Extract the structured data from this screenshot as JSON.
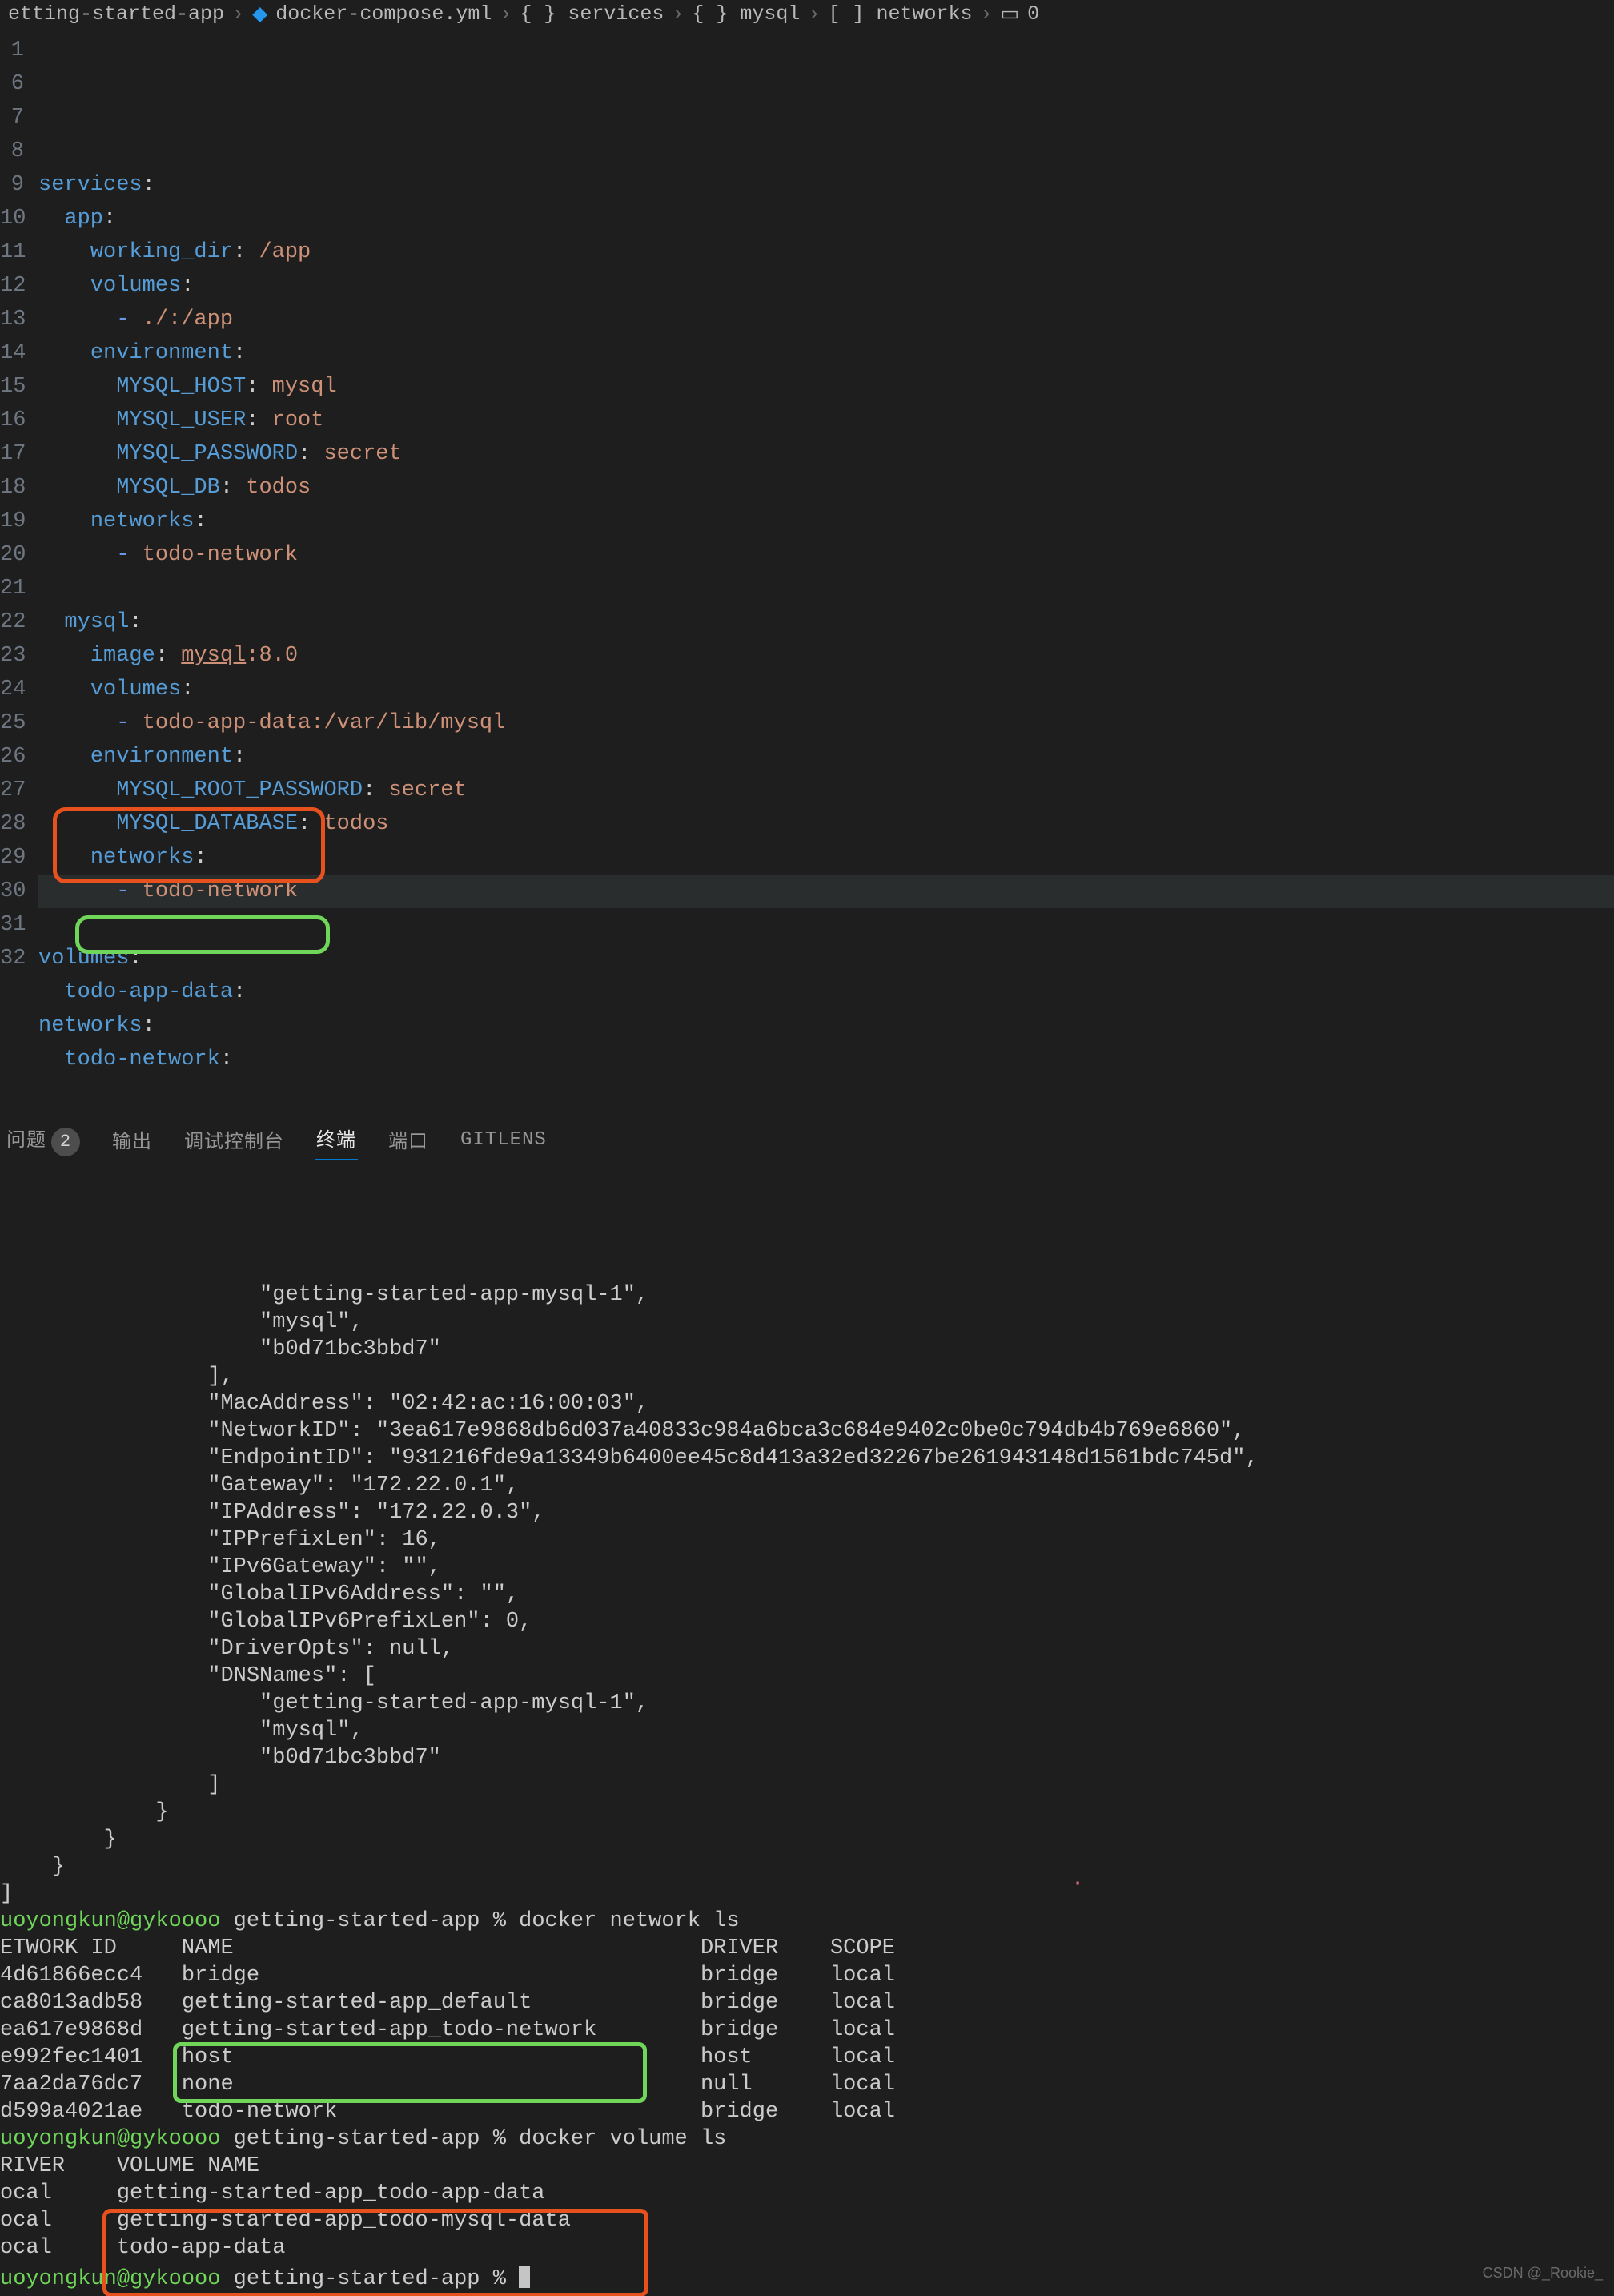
{
  "breadcrumb": {
    "segments": [
      "etting-started-app",
      "docker-compose.yml",
      "{ } services",
      "{ } mysql",
      "[ ] networks",
      "0"
    ],
    "icon_file": "file-icon",
    "icon_array": "array-icon"
  },
  "code": {
    "lines": [
      {
        "n": 1,
        "t": [
          {
            "c": "key",
            "s": "services"
          },
          {
            "c": "pun",
            "s": ":"
          }
        ]
      },
      {
        "n": 6,
        "t": [
          {
            "c": "",
            "s": "  "
          },
          {
            "c": "key",
            "s": "app"
          },
          {
            "c": "pun",
            "s": ":"
          }
        ]
      },
      {
        "n": 7,
        "t": [
          {
            "c": "",
            "s": "    "
          },
          {
            "c": "key",
            "s": "working_dir"
          },
          {
            "c": "pun",
            "s": ": "
          },
          {
            "c": "val",
            "s": "/app"
          }
        ]
      },
      {
        "n": 8,
        "t": [
          {
            "c": "",
            "s": "    "
          },
          {
            "c": "key",
            "s": "volumes"
          },
          {
            "c": "pun",
            "s": ":"
          }
        ]
      },
      {
        "n": 9,
        "t": [
          {
            "c": "",
            "s": "      "
          },
          {
            "c": "lst",
            "s": "- "
          },
          {
            "c": "val",
            "s": "./:/app"
          }
        ]
      },
      {
        "n": 10,
        "t": [
          {
            "c": "",
            "s": "    "
          },
          {
            "c": "key",
            "s": "environment"
          },
          {
            "c": "pun",
            "s": ":"
          }
        ]
      },
      {
        "n": 11,
        "t": [
          {
            "c": "",
            "s": "      "
          },
          {
            "c": "key",
            "s": "MYSQL_HOST"
          },
          {
            "c": "pun",
            "s": ": "
          },
          {
            "c": "val",
            "s": "mysql"
          }
        ]
      },
      {
        "n": 12,
        "t": [
          {
            "c": "",
            "s": "      "
          },
          {
            "c": "key",
            "s": "MYSQL_USER"
          },
          {
            "c": "pun",
            "s": ": "
          },
          {
            "c": "val",
            "s": "root"
          }
        ]
      },
      {
        "n": 13,
        "t": [
          {
            "c": "",
            "s": "      "
          },
          {
            "c": "key",
            "s": "MYSQL_PASSWORD"
          },
          {
            "c": "pun",
            "s": ": "
          },
          {
            "c": "val",
            "s": "secret"
          }
        ]
      },
      {
        "n": 14,
        "t": [
          {
            "c": "",
            "s": "      "
          },
          {
            "c": "key",
            "s": "MYSQL_DB"
          },
          {
            "c": "pun",
            "s": ": "
          },
          {
            "c": "val",
            "s": "todos"
          }
        ]
      },
      {
        "n": 15,
        "t": [
          {
            "c": "",
            "s": "    "
          },
          {
            "c": "key",
            "s": "networks"
          },
          {
            "c": "pun",
            "s": ":"
          }
        ]
      },
      {
        "n": 16,
        "t": [
          {
            "c": "",
            "s": "      "
          },
          {
            "c": "lst",
            "s": "- "
          },
          {
            "c": "val",
            "s": "todo-network"
          }
        ]
      },
      {
        "n": 17,
        "t": []
      },
      {
        "n": 18,
        "t": [
          {
            "c": "",
            "s": "  "
          },
          {
            "c": "key",
            "s": "mysql"
          },
          {
            "c": "pun",
            "s": ":"
          }
        ]
      },
      {
        "n": 19,
        "t": [
          {
            "c": "",
            "s": "    "
          },
          {
            "c": "key",
            "s": "image"
          },
          {
            "c": "pun",
            "s": ": "
          },
          {
            "c": "val u",
            "s": "mysql"
          },
          {
            "c": "val",
            "s": ":8.0"
          }
        ]
      },
      {
        "n": 20,
        "t": [
          {
            "c": "",
            "s": "    "
          },
          {
            "c": "key",
            "s": "volumes"
          },
          {
            "c": "pun",
            "s": ":"
          }
        ]
      },
      {
        "n": 21,
        "t": [
          {
            "c": "",
            "s": "      "
          },
          {
            "c": "lst",
            "s": "- "
          },
          {
            "c": "val",
            "s": "todo-app-data:/var/lib/mysql"
          }
        ]
      },
      {
        "n": 22,
        "t": [
          {
            "c": "",
            "s": "    "
          },
          {
            "c": "key",
            "s": "environment"
          },
          {
            "c": "pun",
            "s": ":"
          }
        ]
      },
      {
        "n": 23,
        "t": [
          {
            "c": "",
            "s": "      "
          },
          {
            "c": "key",
            "s": "MYSQL_ROOT_PASSWORD"
          },
          {
            "c": "pun",
            "s": ": "
          },
          {
            "c": "val",
            "s": "secret"
          }
        ]
      },
      {
        "n": 24,
        "t": [
          {
            "c": "",
            "s": "      "
          },
          {
            "c": "key",
            "s": "MYSQL_DATABASE"
          },
          {
            "c": "pun",
            "s": ": "
          },
          {
            "c": "val",
            "s": "todos"
          }
        ]
      },
      {
        "n": 25,
        "t": [
          {
            "c": "",
            "s": "    "
          },
          {
            "c": "key",
            "s": "networks"
          },
          {
            "c": "pun",
            "s": ":"
          }
        ]
      },
      {
        "n": 26,
        "hl": true,
        "t": [
          {
            "c": "",
            "s": "      "
          },
          {
            "c": "lst",
            "s": "- "
          },
          {
            "c": "val",
            "s": "todo-network"
          }
        ]
      },
      {
        "n": 27,
        "t": []
      },
      {
        "n": 28,
        "t": [
          {
            "c": "key",
            "s": "volumes"
          },
          {
            "c": "pun",
            "s": ":"
          }
        ]
      },
      {
        "n": 29,
        "t": [
          {
            "c": "",
            "s": "  "
          },
          {
            "c": "key",
            "s": "todo-app-data"
          },
          {
            "c": "pun",
            "s": ":"
          }
        ]
      },
      {
        "n": 30,
        "t": [
          {
            "c": "key",
            "s": "networks"
          },
          {
            "c": "pun",
            "s": ":"
          }
        ]
      },
      {
        "n": 31,
        "t": [
          {
            "c": "",
            "s": "  "
          },
          {
            "c": "key",
            "s": "todo-network"
          },
          {
            "c": "pun",
            "s": ":"
          }
        ]
      },
      {
        "n": 32,
        "t": []
      }
    ]
  },
  "panel": {
    "tabs": {
      "problems": "问题",
      "problems_count": "2",
      "output": "输出",
      "debug": "调试控制台",
      "terminal": "终端",
      "ports": "端口",
      "gitlens": "GITLENS"
    }
  },
  "terminal": {
    "json_lines": [
      "                    \"getting-started-app-mysql-1\",",
      "                    \"mysql\",",
      "                    \"b0d71bc3bbd7\"",
      "                ],",
      "                \"MacAddress\": \"02:42:ac:16:00:03\",",
      "                \"NetworkID\": \"3ea617e9868db6d037a40833c984a6bca3c684e9402c0be0c794db4b769e6860\",",
      "                \"EndpointID\": \"931216fde9a13349b6400ee45c8d413a32ed32267be261943148d1561bdc745d\",",
      "                \"Gateway\": \"172.22.0.1\",",
      "                \"IPAddress\": \"172.22.0.3\",",
      "                \"IPPrefixLen\": 16,",
      "                \"IPv6Gateway\": \"\",",
      "                \"GlobalIPv6Address\": \"\",",
      "                \"GlobalIPv6PrefixLen\": 0,",
      "                \"DriverOpts\": null,",
      "                \"DNSNames\": [",
      "                    \"getting-started-app-mysql-1\",",
      "                    \"mysql\",",
      "                    \"b0d71bc3bbd7\"",
      "                ]",
      "            }",
      "        }",
      "    }",
      "]"
    ],
    "prompt_user": "uoyongkun@gykoooo",
    "prompt_dir": "getting-started-app",
    "cmd_network": "docker network ls",
    "net_header": "ETWORK ID     NAME                                    DRIVER    SCOPE",
    "net_rows": [
      {
        "id": "4d61866ecc4",
        "name": "bridge",
        "driver": "bridge",
        "scope": "local"
      },
      {
        "id": "ca8013adb58",
        "name": "getting-started-app_default",
        "driver": "bridge",
        "scope": "local"
      },
      {
        "id": "ea617e9868d",
        "name": "getting-started-app_todo-network",
        "driver": "bridge",
        "scope": "local"
      },
      {
        "id": "e992fec1401",
        "name": "host",
        "driver": "host",
        "scope": "local"
      },
      {
        "id": "7aa2da76dc7",
        "name": "none",
        "driver": "null",
        "scope": "local"
      },
      {
        "id": "d599a4021ae",
        "name": "todo-network",
        "driver": "bridge",
        "scope": "local"
      }
    ],
    "cmd_volume": "docker volume ls",
    "vol_header": "RIVER    VOLUME NAME",
    "vol_rows": [
      {
        "driver": "ocal",
        "name": "getting-started-app_todo-app-data"
      },
      {
        "driver": "ocal",
        "name": "getting-started-app_todo-mysql-data"
      },
      {
        "driver": "ocal",
        "name": "todo-app-data"
      }
    ],
    "watermark": "CSDN @_Rookie_"
  }
}
